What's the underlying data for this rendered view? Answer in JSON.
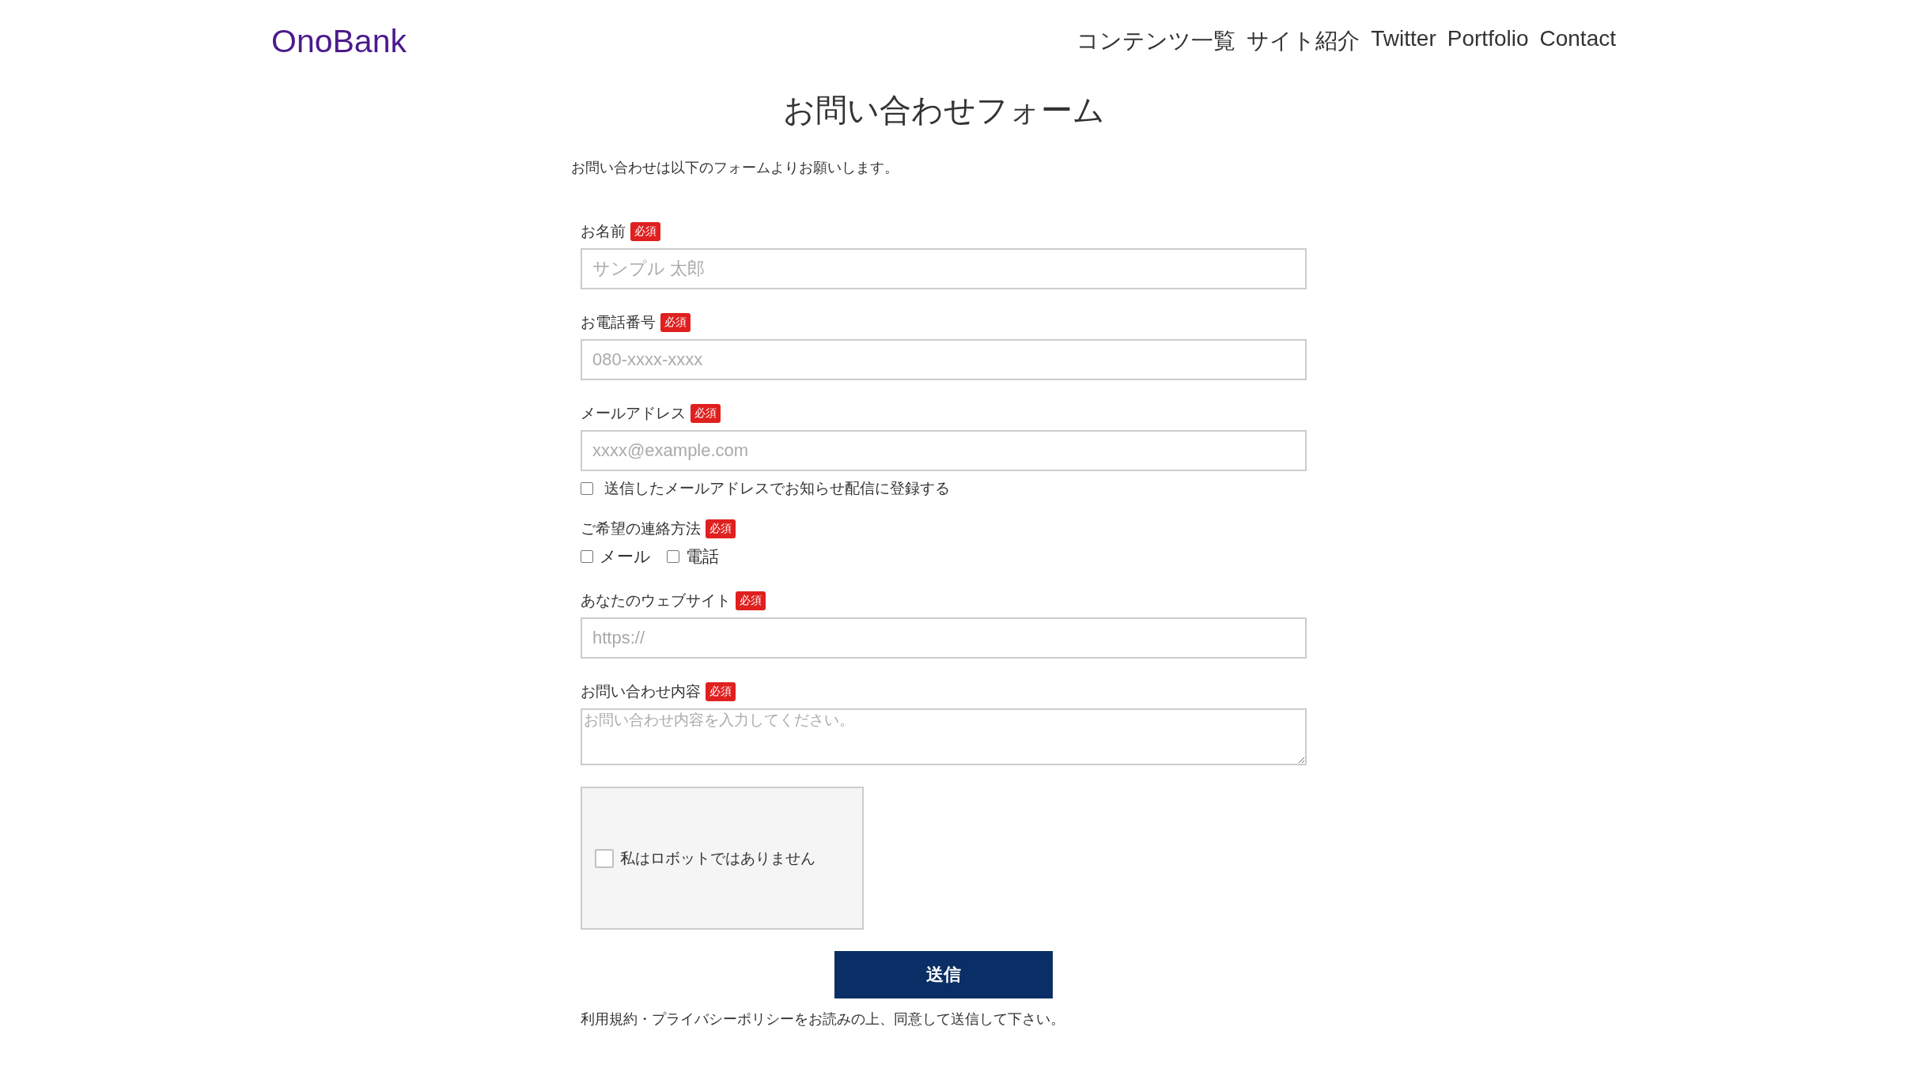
{
  "header": {
    "logo": "OnoBank",
    "nav": [
      "コンテンツ一覧",
      "サイト紹介",
      "Twitter",
      "Portfolio",
      "Contact"
    ]
  },
  "title": "お問い合わせフォーム",
  "intro": "お問い合わせは以下のフォームよりお願いします。",
  "fields": [
    {
      "kind": "input",
      "label": "お名前",
      "badge": "必須",
      "placeholder": "サンプル 太郎"
    },
    {
      "kind": "input",
      "label": "お電話番号",
      "badge": "必須",
      "placeholder": "080-xxxx-xxxx"
    },
    {
      "kind": "input",
      "label": "メールアドレス",
      "badge": "必須",
      "placeholder": "xxxx@example.com",
      "option": {
        "label": "送信したメールアドレスでお知らせ配信に登録する",
        "checked": false
      }
    },
    {
      "kind": "checkboxes",
      "label": "ご希望の連絡方法",
      "badge": "必須",
      "options": [
        {
          "label": "メール",
          "checked": false
        },
        {
          "label": "電話",
          "checked": false
        }
      ]
    },
    {
      "kind": "input",
      "label": "あなたのウェブサイト",
      "badge": "必須",
      "placeholder": "https://"
    },
    {
      "kind": "textarea",
      "label": "お問い合わせ内容",
      "badge": "必須",
      "placeholder": "お問い合わせ内容を入力してください。"
    }
  ],
  "captcha": {
    "label": "私はロボットではありません",
    "checked": false
  },
  "submit": "送信",
  "note": "利用規約・プライバシーポリシーをお読みの上、同意して送信して下さい。"
}
